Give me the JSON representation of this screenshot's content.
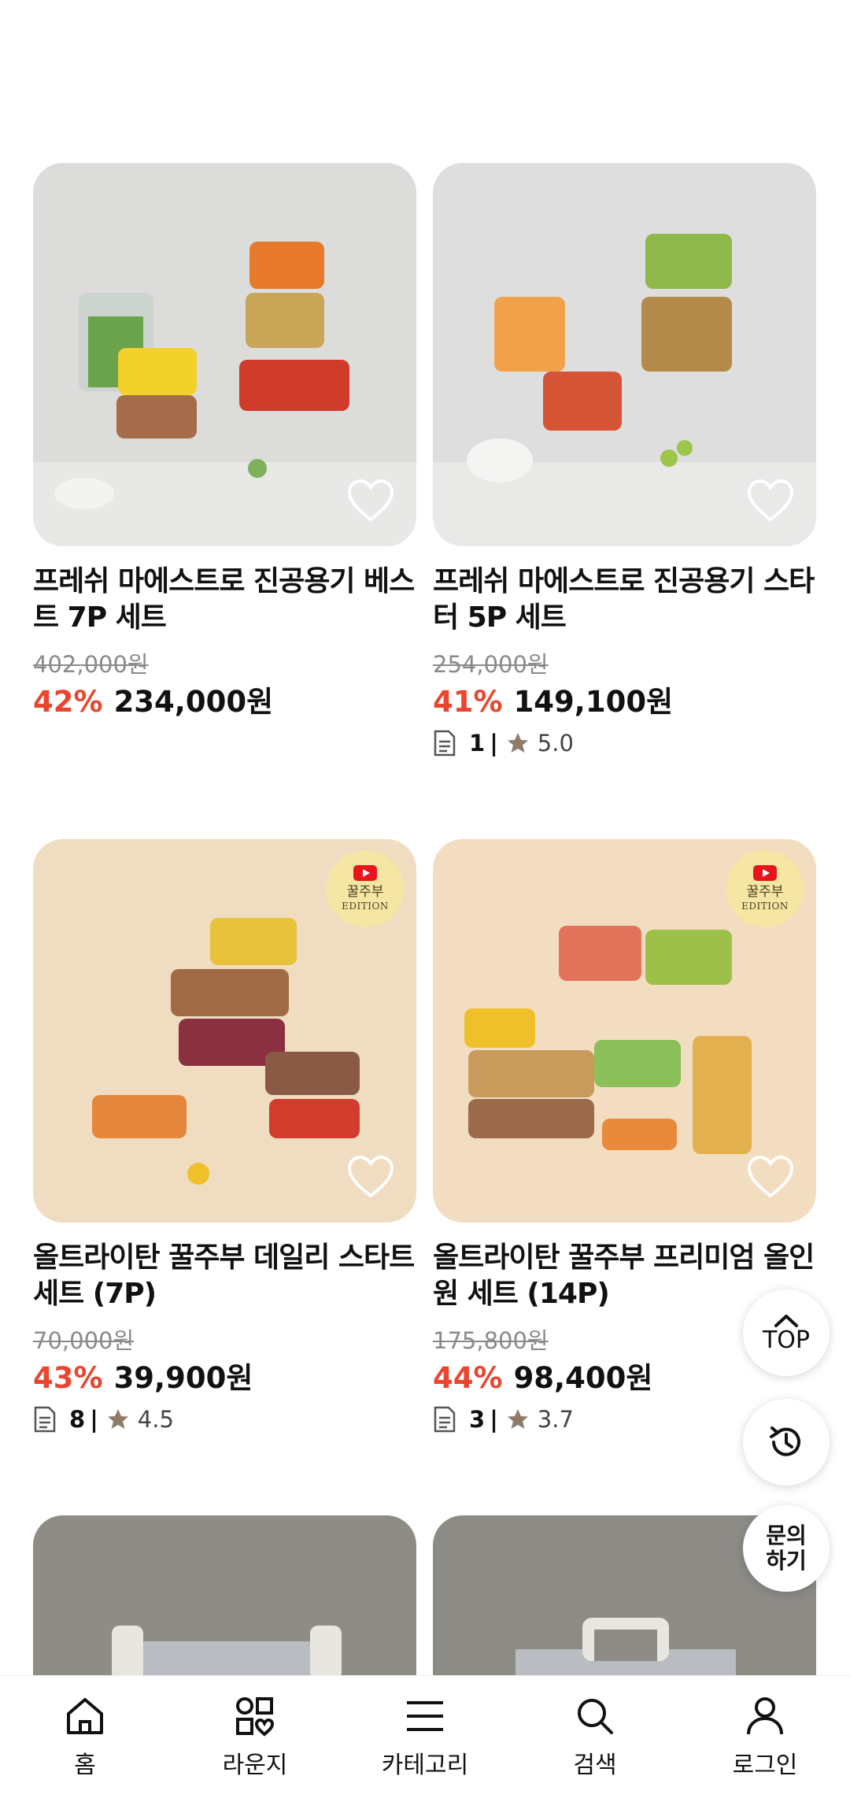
{
  "products": [
    {
      "title": "프레쉬 마에스트로 진공용기 베스트 7P 세트",
      "original_price": "402,000원",
      "discount": "42%",
      "price": "234,000원",
      "review_count": "",
      "rating": "",
      "badge": false
    },
    {
      "title": "프레쉬 마에스트로 진공용기 스타터 5P 세트",
      "original_price": "254,000원",
      "discount": "41%",
      "price": "149,100원",
      "review_count": "1",
      "rating": "5.0",
      "badge": false
    },
    {
      "title": "올트라이탄 꿀주부 데일리 스타트 세트 (7P)",
      "original_price": "70,000원",
      "discount": "43%",
      "price": "39,900원",
      "review_count": "8",
      "rating": "4.5",
      "badge": true
    },
    {
      "title": "올트라이탄 꿀주부 프리미엄 올인원 세트 (14P)",
      "original_price": "175,800원",
      "discount": "44%",
      "price": "98,400원",
      "review_count": "3",
      "rating": "3.7",
      "badge": true
    }
  ],
  "badge": {
    "line1": "꿀주부",
    "line2": "EDITION"
  },
  "meta_separator": "|",
  "floating": {
    "top_label": "TOP",
    "inquiry_label": "문의 하기"
  },
  "tabbar": {
    "items": [
      {
        "label": "홈",
        "icon": "home-icon"
      },
      {
        "label": "라운지",
        "icon": "lounge-icon"
      },
      {
        "label": "카테고리",
        "icon": "menu-icon"
      },
      {
        "label": "검색",
        "icon": "search-icon"
      },
      {
        "label": "로그인",
        "icon": "person-icon"
      }
    ]
  },
  "colors": {
    "discount": "#e9452f",
    "strike": "#8a8a8a",
    "badge_bg": "#f6e6a4",
    "youtube": "#e8141b"
  }
}
